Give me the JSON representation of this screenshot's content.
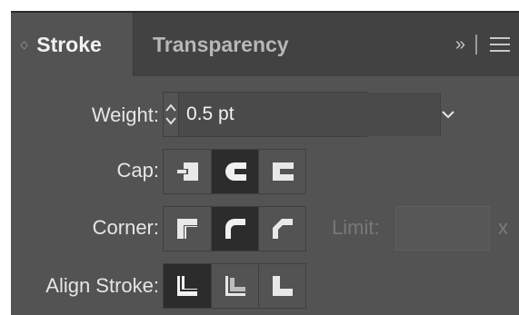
{
  "tabs": {
    "stroke_label": "Stroke",
    "transparency_label": "Transparency",
    "overflow_glyph": "»"
  },
  "weight": {
    "label": "Weight:",
    "value": "0.5 pt"
  },
  "cap": {
    "label": "Cap:",
    "options": [
      "butt-cap",
      "round-cap",
      "projecting-cap"
    ],
    "selected": "round-cap"
  },
  "corner": {
    "label": "Corner:",
    "options": [
      "miter-join",
      "round-join",
      "bevel-join"
    ],
    "selected": "round-join",
    "limit_label": "Limit:",
    "limit_value": "",
    "limit_unit": "x"
  },
  "align_stroke": {
    "label": "Align Stroke:",
    "options": [
      "align-center",
      "align-inside",
      "align-outside"
    ],
    "selected": "align-center"
  },
  "colors": {
    "panel_bg": "#535353",
    "tabbar_bg": "#424242",
    "active_button_bg": "#2c2c2c",
    "icon_fill": "#e8e8e8"
  }
}
